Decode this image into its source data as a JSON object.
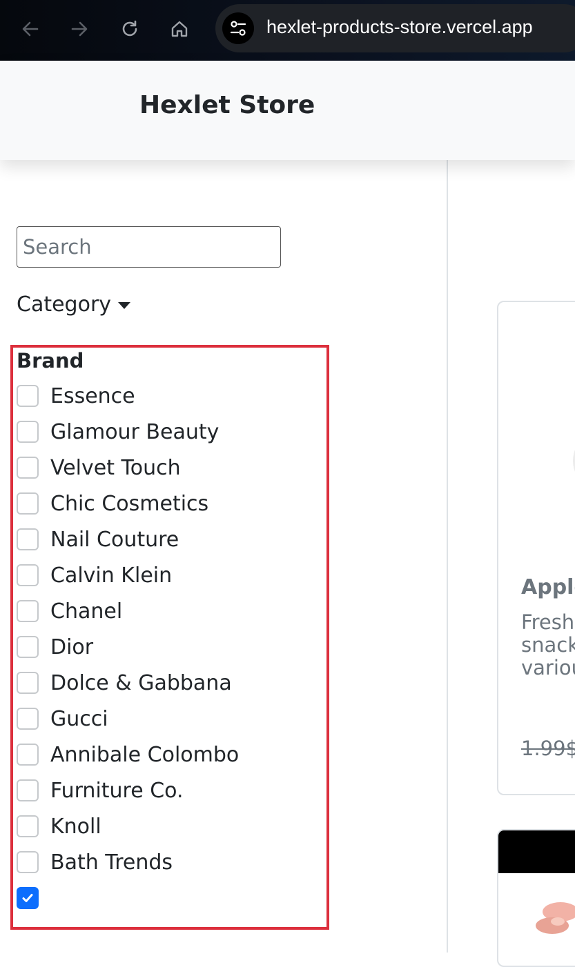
{
  "browser": {
    "url": "hexlet-products-store.vercel.app",
    "icons": [
      "back-arrow-icon",
      "forward-arrow-icon",
      "reload-icon",
      "home-icon",
      "site-settings-icon"
    ]
  },
  "navbar": {
    "brand": "Hexlet Store"
  },
  "sidebar": {
    "search": {
      "placeholder": "Search",
      "value": ""
    },
    "category_label": "Category",
    "brand": {
      "title": "Brand",
      "items": [
        {
          "label": "Essence",
          "checked": false
        },
        {
          "label": "Glamour Beauty",
          "checked": false
        },
        {
          "label": "Velvet Touch",
          "checked": false
        },
        {
          "label": "Chic Cosmetics",
          "checked": false
        },
        {
          "label": "Nail Couture",
          "checked": false
        },
        {
          "label": "Calvin Klein",
          "checked": false
        },
        {
          "label": "Chanel",
          "checked": false
        },
        {
          "label": "Dior",
          "checked": false
        },
        {
          "label": "Dolce & Gabbana",
          "checked": false
        },
        {
          "label": "Gucci",
          "checked": false
        },
        {
          "label": "Annibale Colombo",
          "checked": false
        },
        {
          "label": "Furniture Co.",
          "checked": false
        },
        {
          "label": "Knoll",
          "checked": false
        },
        {
          "label": "Bath Trends",
          "checked": false
        },
        {
          "label": "",
          "checked": true
        }
      ]
    }
  },
  "products": [
    {
      "title": "Apple",
      "description_lines": [
        "Fresh",
        "snack",
        "variou"
      ],
      "old_price": "1.99$"
    }
  ],
  "colors": {
    "highlight_border": "#dc2f3c",
    "checkbox_checked": "#0d6efd"
  }
}
